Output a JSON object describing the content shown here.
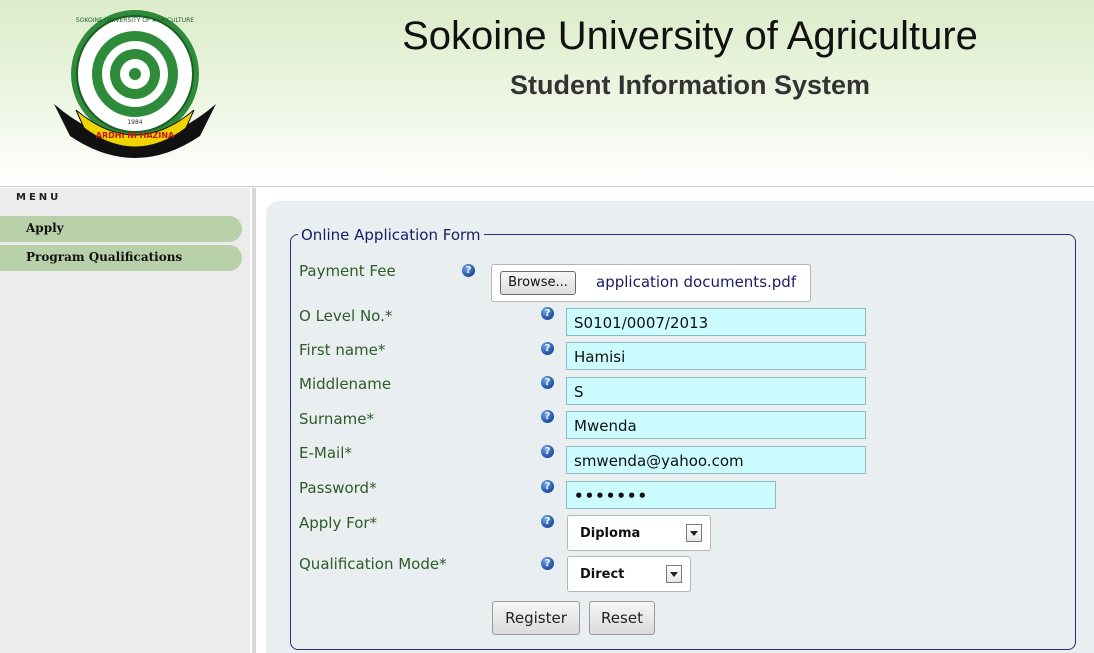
{
  "header": {
    "title": "Sokoine University of Agriculture",
    "subtitle": "Student Information System",
    "logo": {
      "ring_text": "SOKOINE UNIVERSITY OF AGRICULTURE",
      "year": "1984",
      "motto": "ARDHI NI HAZINA"
    }
  },
  "sidebar": {
    "menu_label": "MENU",
    "items": [
      {
        "label": "Apply"
      },
      {
        "label": "Program Qualifications"
      }
    ]
  },
  "form": {
    "legend": "Online Application Form",
    "payment_fee": {
      "label": "Payment Fee",
      "browse_label": "Browse...",
      "file_name": "application documents.pdf"
    },
    "fields": [
      {
        "label": "O Level No.*",
        "value": "S0101/0007/2013"
      },
      {
        "label": "First name*",
        "value": "Hamisi"
      },
      {
        "label": "Middlename",
        "value": "S"
      },
      {
        "label": "Surname*",
        "value": "Mwenda"
      },
      {
        "label": "E-Mail*",
        "value": "smwenda@yahoo.com"
      },
      {
        "label": "Password*",
        "value": "•••••••"
      }
    ],
    "apply_for": {
      "label": "Apply For*",
      "value": "Diploma"
    },
    "qualification_mode": {
      "label": "Qualification Mode*",
      "value": "Direct"
    },
    "register_label": "Register",
    "reset_label": "Reset",
    "help_glyph": "?"
  },
  "colors": {
    "header_green": "#dcecc9",
    "menu_green": "#b8d1a8",
    "input_cyan": "#ccfcff",
    "label_green": "#2f5a29",
    "legend_navy": "#1a1a66"
  }
}
